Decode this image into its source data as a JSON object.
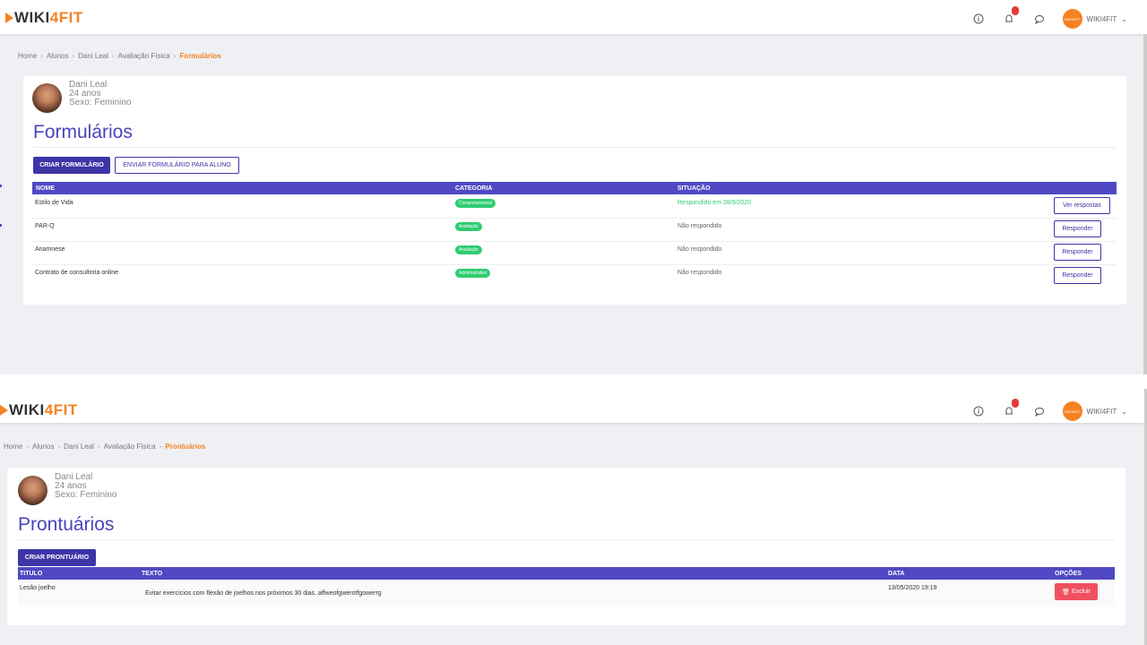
{
  "brand": {
    "logo_part1": "WIKI",
    "logo_part2": "4FIT"
  },
  "header": {
    "user_name": "WIKI4FIT",
    "user_avatar_text": "WIKI4FIT",
    "notification_icon": "bell-icon",
    "info_icon": "info-icon",
    "chat_icon": "chat-icon"
  },
  "student": {
    "name": "Dani Leal",
    "age": "24 anos",
    "sex": "Sexo: Feminino"
  },
  "forms_page": {
    "breadcrumb": [
      "Home",
      "Alunos",
      "Dani Leal",
      "Avaliação Física",
      "Formulários"
    ],
    "title": "Formulários",
    "create_button": "CRIAR FORMULÁRIO",
    "send_button": "ENVIAR FORMULÁRIO PARA ALUNO",
    "columns": {
      "name": "NOME",
      "category": "CATEGORIA",
      "status": "SITUAÇÃO"
    },
    "rows": [
      {
        "name": "Estilo de Vida",
        "category": "Comportamental",
        "status": "Respondido em 28/9/2020",
        "action": "Ver respostas"
      },
      {
        "name": "PAR-Q",
        "category": "Avaliação",
        "status": "Não respondido",
        "action": "Responder"
      },
      {
        "name": "Anamnese",
        "category": "Avaliação",
        "status": "Não respondido",
        "action": "Responder"
      },
      {
        "name": "Contrato de consultoria online",
        "category": "Administrativo",
        "status": "Não respondido",
        "action": "Responder"
      }
    ]
  },
  "records_page": {
    "breadcrumb": [
      "Home",
      "Alunos",
      "Dani Leal",
      "Avaliação Física",
      "Prontuários"
    ],
    "title": "Prontuários",
    "create_button": "CRIAR PRONTUÁRIO",
    "columns": {
      "title": "TITULO",
      "text": "TEXTO",
      "date": "DATA",
      "options": "OPÇÕES"
    },
    "rows": [
      {
        "title": "Lesão joelho",
        "text": "Evitar exercícios com flexão de joelhos nos próximos 30 dias. affweofgwerotfgowerrg",
        "date": "13/05/2020 19:19",
        "action": "Excluir"
      }
    ]
  },
  "colors": {
    "accent": "#f58220",
    "primary": "#3d34a6",
    "table_header": "#5048c4",
    "success": "#2ecc71",
    "danger": "#f0505f"
  }
}
